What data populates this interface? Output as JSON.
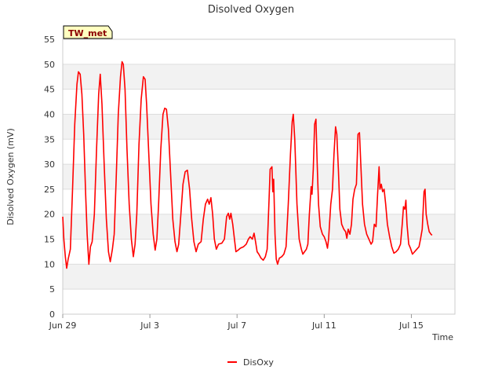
{
  "chart_data": {
    "type": "line",
    "title": "Disolved Oxygen",
    "xlabel": "Time",
    "ylabel": "Disolved Oxygen (mV)",
    "site_label": "TW_met",
    "ylim": [
      0,
      55
    ],
    "yticks": [
      0,
      5,
      10,
      15,
      20,
      25,
      30,
      35,
      40,
      45,
      50,
      55
    ],
    "xlim": [
      0,
      18
    ],
    "xticks": [
      {
        "day": 0,
        "label": "Jun 29"
      },
      {
        "day": 4,
        "label": "Jul 3"
      },
      {
        "day": 8,
        "label": "Jul 7"
      },
      {
        "day": 12,
        "label": "Jul 11"
      },
      {
        "day": 16,
        "label": "Jul 15"
      }
    ],
    "grid": true,
    "legend_position": "bottom",
    "colors": {
      "series": "#ff0000",
      "band": "#f2f2f2",
      "label_bg": "#ffffc0",
      "label_text": "#8b0000"
    },
    "series": [
      {
        "name": "DisOxy",
        "points": [
          [
            0.0,
            19.5
          ],
          [
            0.05,
            15.0
          ],
          [
            0.12,
            11.5
          ],
          [
            0.18,
            9.2
          ],
          [
            0.25,
            11.0
          ],
          [
            0.35,
            13.0
          ],
          [
            0.45,
            25.0
          ],
          [
            0.55,
            38.0
          ],
          [
            0.65,
            46.0
          ],
          [
            0.72,
            48.5
          ],
          [
            0.8,
            48.0
          ],
          [
            0.88,
            44.0
          ],
          [
            0.96,
            36.0
          ],
          [
            1.05,
            24.0
          ],
          [
            1.12,
            16.0
          ],
          [
            1.2,
            10.0
          ],
          [
            1.27,
            13.5
          ],
          [
            1.35,
            14.5
          ],
          [
            1.45,
            20.0
          ],
          [
            1.55,
            33.0
          ],
          [
            1.65,
            44.0
          ],
          [
            1.72,
            48.0
          ],
          [
            1.8,
            42.0
          ],
          [
            1.9,
            30.0
          ],
          [
            2.0,
            19.0
          ],
          [
            2.1,
            12.5
          ],
          [
            2.18,
            10.5
          ],
          [
            2.28,
            13.0
          ],
          [
            2.36,
            16.0
          ],
          [
            2.45,
            27.0
          ],
          [
            2.55,
            40.0
          ],
          [
            2.65,
            47.5
          ],
          [
            2.72,
            50.5
          ],
          [
            2.78,
            50.0
          ],
          [
            2.86,
            45.0
          ],
          [
            2.95,
            33.0
          ],
          [
            3.05,
            22.0
          ],
          [
            3.15,
            15.0
          ],
          [
            3.24,
            11.5
          ],
          [
            3.32,
            14.0
          ],
          [
            3.4,
            20.0
          ],
          [
            3.5,
            34.0
          ],
          [
            3.6,
            43.0
          ],
          [
            3.7,
            47.5
          ],
          [
            3.78,
            47.0
          ],
          [
            3.85,
            42.0
          ],
          [
            3.95,
            32.0
          ],
          [
            4.05,
            22.0
          ],
          [
            4.15,
            16.0
          ],
          [
            4.24,
            12.8
          ],
          [
            4.32,
            15.0
          ],
          [
            4.4,
            22.0
          ],
          [
            4.5,
            33.0
          ],
          [
            4.6,
            40.0
          ],
          [
            4.68,
            41.2
          ],
          [
            4.76,
            41.0
          ],
          [
            4.85,
            37.0
          ],
          [
            4.95,
            28.0
          ],
          [
            5.05,
            19.0
          ],
          [
            5.15,
            14.5
          ],
          [
            5.24,
            12.5
          ],
          [
            5.32,
            14.0
          ],
          [
            5.42,
            20.0
          ],
          [
            5.52,
            26.0
          ],
          [
            5.62,
            28.5
          ],
          [
            5.72,
            28.8
          ],
          [
            5.82,
            25.0
          ],
          [
            5.92,
            19.0
          ],
          [
            6.02,
            14.5
          ],
          [
            6.12,
            12.5
          ],
          [
            6.22,
            14.0
          ],
          [
            6.35,
            14.5
          ],
          [
            6.45,
            19.0
          ],
          [
            6.55,
            22.0
          ],
          [
            6.65,
            23.0
          ],
          [
            6.72,
            22.0
          ],
          [
            6.8,
            23.3
          ],
          [
            6.88,
            20.0
          ],
          [
            6.96,
            15.0
          ],
          [
            7.05,
            13.0
          ],
          [
            7.15,
            14.0
          ],
          [
            7.3,
            14.2
          ],
          [
            7.42,
            15.0
          ],
          [
            7.52,
            19.5
          ],
          [
            7.6,
            20.2
          ],
          [
            7.66,
            19.0
          ],
          [
            7.72,
            20.2
          ],
          [
            7.8,
            18.0
          ],
          [
            7.88,
            15.0
          ],
          [
            7.95,
            12.5
          ],
          [
            8.05,
            12.8
          ],
          [
            8.15,
            13.2
          ],
          [
            8.3,
            13.5
          ],
          [
            8.42,
            14.0
          ],
          [
            8.52,
            15.0
          ],
          [
            8.6,
            15.5
          ],
          [
            8.7,
            15.0
          ],
          [
            8.78,
            16.2
          ],
          [
            8.85,
            14.5
          ],
          [
            8.92,
            12.5
          ],
          [
            9.0,
            12.0
          ],
          [
            9.1,
            11.2
          ],
          [
            9.2,
            10.8
          ],
          [
            9.3,
            11.5
          ],
          [
            9.38,
            13.0
          ],
          [
            9.46,
            22.0
          ],
          [
            9.52,
            29.0
          ],
          [
            9.6,
            29.5
          ],
          [
            9.64,
            24.5
          ],
          [
            9.68,
            27.0
          ],
          [
            9.74,
            16.0
          ],
          [
            9.8,
            11.0
          ],
          [
            9.86,
            10.0
          ],
          [
            9.94,
            11.2
          ],
          [
            10.05,
            11.5
          ],
          [
            10.15,
            12.0
          ],
          [
            10.25,
            13.5
          ],
          [
            10.35,
            22.0
          ],
          [
            10.45,
            32.0
          ],
          [
            10.53,
            38.5
          ],
          [
            10.58,
            40.0
          ],
          [
            10.65,
            35.0
          ],
          [
            10.75,
            22.0
          ],
          [
            10.85,
            15.0
          ],
          [
            10.95,
            13.0
          ],
          [
            11.02,
            12.0
          ],
          [
            11.1,
            12.5
          ],
          [
            11.18,
            13.0
          ],
          [
            11.25,
            14.0
          ],
          [
            11.32,
            20.0
          ],
          [
            11.4,
            25.5
          ],
          [
            11.44,
            24.0
          ],
          [
            11.5,
            29.0
          ],
          [
            11.56,
            38.0
          ],
          [
            11.62,
            39.0
          ],
          [
            11.68,
            30.0
          ],
          [
            11.74,
            22.0
          ],
          [
            11.82,
            17.5
          ],
          [
            11.92,
            16.0
          ],
          [
            12.0,
            15.5
          ],
          [
            12.08,
            14.5
          ],
          [
            12.15,
            13.2
          ],
          [
            12.2,
            15.0
          ],
          [
            12.3,
            22.0
          ],
          [
            12.38,
            25.0
          ],
          [
            12.45,
            32.0
          ],
          [
            12.52,
            37.5
          ],
          [
            12.58,
            36.0
          ],
          [
            12.65,
            29.0
          ],
          [
            12.72,
            21.0
          ],
          [
            12.8,
            18.0
          ],
          [
            12.9,
            17.0
          ],
          [
            12.98,
            16.5
          ],
          [
            13.04,
            15.2
          ],
          [
            13.1,
            17.0
          ],
          [
            13.18,
            16.0
          ],
          [
            13.25,
            18.0
          ],
          [
            13.32,
            23.0
          ],
          [
            13.4,
            25.0
          ],
          [
            13.48,
            26.0
          ],
          [
            13.55,
            36.0
          ],
          [
            13.62,
            36.3
          ],
          [
            13.68,
            30.0
          ],
          [
            13.76,
            22.0
          ],
          [
            13.85,
            18.0
          ],
          [
            13.95,
            16.0
          ],
          [
            14.05,
            15.0
          ],
          [
            14.15,
            14.0
          ],
          [
            14.22,
            14.5
          ],
          [
            14.3,
            18.0
          ],
          [
            14.38,
            17.5
          ],
          [
            14.45,
            24.0
          ],
          [
            14.52,
            29.5
          ],
          [
            14.56,
            25.0
          ],
          [
            14.62,
            26.0
          ],
          [
            14.68,
            24.5
          ],
          [
            14.75,
            25.0
          ],
          [
            14.82,
            22.0
          ],
          [
            14.9,
            18.0
          ],
          [
            15.0,
            15.5
          ],
          [
            15.1,
            13.5
          ],
          [
            15.2,
            12.2
          ],
          [
            15.3,
            12.5
          ],
          [
            15.4,
            13.0
          ],
          [
            15.5,
            14.0
          ],
          [
            15.58,
            18.0
          ],
          [
            15.64,
            21.5
          ],
          [
            15.7,
            21.0
          ],
          [
            15.75,
            22.8
          ],
          [
            15.8,
            18.0
          ],
          [
            15.88,
            14.0
          ],
          [
            15.96,
            13.2
          ],
          [
            16.05,
            12.0
          ],
          [
            16.15,
            12.5
          ],
          [
            16.25,
            13.0
          ],
          [
            16.35,
            13.5
          ],
          [
            16.42,
            15.0
          ],
          [
            16.5,
            17.0
          ],
          [
            16.58,
            24.5
          ],
          [
            16.63,
            25.0
          ],
          [
            16.68,
            20.0
          ],
          [
            16.75,
            18.0
          ],
          [
            16.82,
            16.5
          ],
          [
            16.9,
            16.0
          ],
          [
            16.95,
            15.8
          ]
        ]
      }
    ]
  }
}
